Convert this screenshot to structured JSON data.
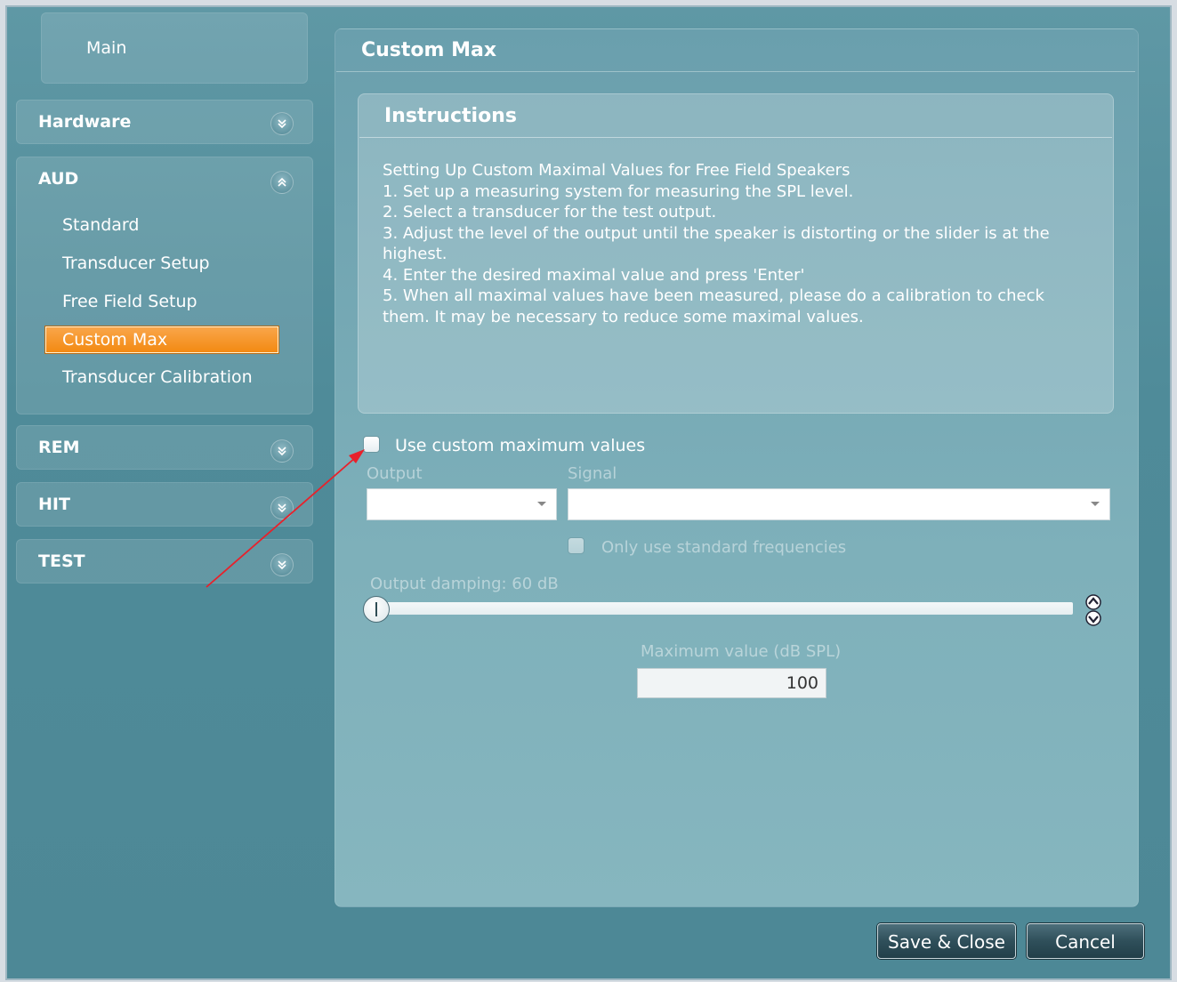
{
  "sidebar": {
    "main_label": "Main",
    "sections": [
      {
        "label": "Hardware",
        "expanded": false
      },
      {
        "label": "AUD",
        "expanded": true
      },
      {
        "label": "REM",
        "expanded": false
      },
      {
        "label": "HIT",
        "expanded": false
      },
      {
        "label": "TEST",
        "expanded": false
      }
    ],
    "aud_items": [
      "Standard",
      "Transducer Setup",
      "Free Field Setup",
      "Custom Max",
      "Transducer Calibration"
    ],
    "active_item": "Custom Max"
  },
  "content": {
    "title": "Custom Max",
    "instructions": {
      "title": "Instructions",
      "lines": [
        "Setting Up Custom Maximal Values for Free Field Speakers",
        "1. Set up a measuring system for measuring the SPL level.",
        "2. Select a transducer for the test output.",
        "3. Adjust the level of the output until the speaker is distorting or the slider is at the highest.",
        "4. Enter the desired maximal value and press 'Enter'",
        "5. When all maximal values have been measured, please do a calibration to check them. It may be necessary to reduce some maximal values."
      ]
    },
    "use_custom_label": "Use custom maximum values",
    "use_custom_checked": false,
    "output_label": "Output",
    "output_value": "",
    "signal_label": "Signal",
    "signal_value": "",
    "only_standard_label": "Only use standard frequencies",
    "only_standard_checked": false,
    "output_damping_label": "Output damping: 60 dB",
    "slider_level": 0,
    "max_value_label": "Maximum value (dB SPL)",
    "max_value": "100"
  },
  "footer": {
    "save_close_label": "Save & Close",
    "cancel_label": "Cancel"
  },
  "colors": {
    "background": "#4f8b99",
    "accent_active": "#f38a12",
    "annotation_arrow": "#e8212b"
  },
  "icons": {
    "section_collapsed": "chevron-double-down-icon",
    "section_expanded": "chevron-double-up-icon",
    "dropdown": "caret-down-icon",
    "spinner": "up-down-spinner-icon"
  }
}
